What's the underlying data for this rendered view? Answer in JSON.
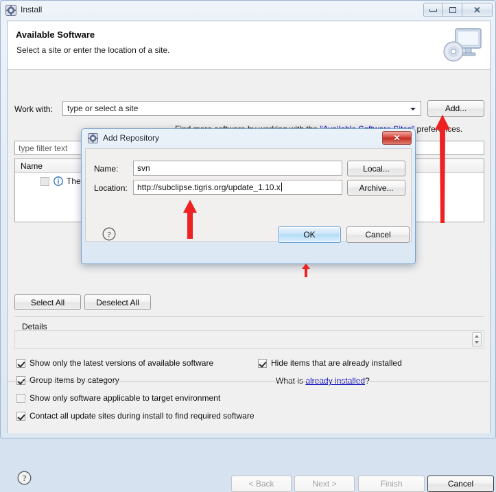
{
  "window": {
    "title": "Install",
    "icon": "install-gear-icon",
    "controls": {
      "minimize": "Minimize",
      "maximize": "Maximize",
      "close": "Close"
    }
  },
  "banner": {
    "title": "Available Software",
    "subtitle": "Select a site or enter the location of a site.",
    "icon": "monitor-disc-icon"
  },
  "page": {
    "work_with_label": "Work with:",
    "work_with_value": "type or select a site",
    "add_button": "Add...",
    "find_more_prefix": "Find more software by working with the ",
    "find_more_link": "\"Available Software Sites\"",
    "find_more_suffix": " preferences.",
    "filter_placeholder": "type filter text",
    "tree_column_name": "Name",
    "tree_row_label": "There i",
    "tree_row_icon": "info-icon",
    "select_all_button": "Select All",
    "deselect_all_button": "Deselect All",
    "details_label": "Details"
  },
  "options": [
    {
      "label": "Show only the latest versions of available software",
      "checked": true
    },
    {
      "label": "Group items by category",
      "checked": true
    },
    {
      "label": "Show only software applicable to target environment",
      "checked": false
    },
    {
      "label": "Contact all update sites during install to find required software",
      "checked": true
    },
    {
      "label": "Hide items that are already installed",
      "checked": true
    }
  ],
  "what_is": {
    "prefix": "What is ",
    "link": "already installed",
    "suffix": "?"
  },
  "footer": {
    "help_icon": "help-question-icon",
    "back_button": "< Back",
    "next_button": "Next >",
    "finish_button": "Finish",
    "cancel_button": "Cancel"
  },
  "dialog": {
    "title": "Add Repository",
    "icon": "install-gear-icon",
    "close_glyph": "✕",
    "name_label": "Name:",
    "name_value": "svn",
    "location_label": "Location:",
    "location_value": "http://subclipse.tigris.org/update_1.10.x",
    "local_button": "Local...",
    "archive_button": "Archive...",
    "help_icon": "help-question-icon",
    "ok_button": "OK",
    "cancel_button": "Cancel"
  },
  "annotations": {
    "arrow_color": "#ee2222",
    "arrows": [
      {
        "name": "arrow-to-available-software-sites-link"
      },
      {
        "name": "arrow-to-location-field"
      },
      {
        "name": "arrow-to-ok-button"
      }
    ]
  }
}
